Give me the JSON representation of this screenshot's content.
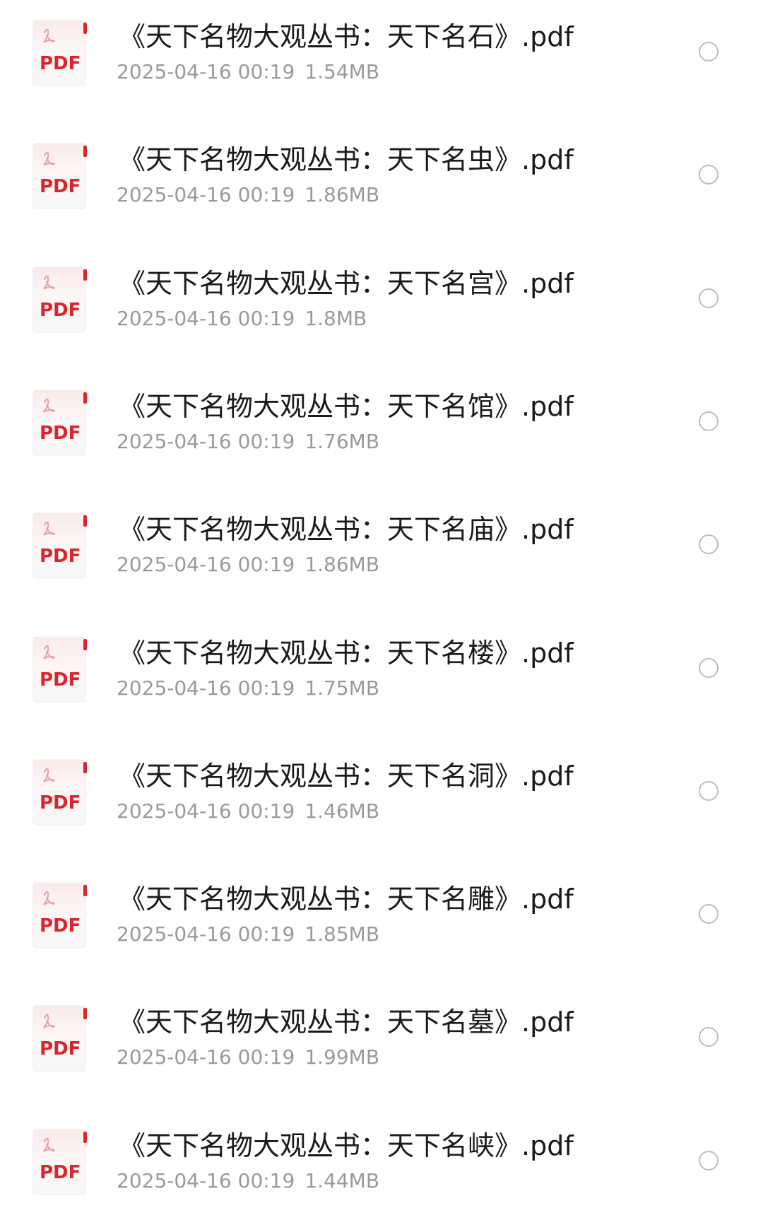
{
  "files": [
    {
      "name": "《天下名物大观丛书：天下名石》.pdf",
      "date": "2025-04-16 00:19",
      "size": "1.54MB",
      "icon": "pdf-file-icon",
      "icon_label": "PDF"
    },
    {
      "name": "《天下名物大观丛书：天下名虫》.pdf",
      "date": "2025-04-16 00:19",
      "size": "1.86MB",
      "icon": "pdf-file-icon",
      "icon_label": "PDF"
    },
    {
      "name": "《天下名物大观丛书：天下名宫》.pdf",
      "date": "2025-04-16 00:19",
      "size": "1.8MB",
      "icon": "pdf-file-icon",
      "icon_label": "PDF"
    },
    {
      "name": "《天下名物大观丛书：天下名馆》.pdf",
      "date": "2025-04-16 00:19",
      "size": "1.76MB",
      "icon": "pdf-file-icon",
      "icon_label": "PDF"
    },
    {
      "name": "《天下名物大观丛书：天下名庙》.pdf",
      "date": "2025-04-16 00:19",
      "size": "1.86MB",
      "icon": "pdf-file-icon",
      "icon_label": "PDF"
    },
    {
      "name": "《天下名物大观丛书：天下名楼》.pdf",
      "date": "2025-04-16 00:19",
      "size": "1.75MB",
      "icon": "pdf-file-icon",
      "icon_label": "PDF"
    },
    {
      "name": "《天下名物大观丛书：天下名洞》.pdf",
      "date": "2025-04-16 00:19",
      "size": "1.46MB",
      "icon": "pdf-file-icon",
      "icon_label": "PDF"
    },
    {
      "name": "《天下名物大观丛书：天下名雕》.pdf",
      "date": "2025-04-16 00:19",
      "size": "1.85MB",
      "icon": "pdf-file-icon",
      "icon_label": "PDF"
    },
    {
      "name": "《天下名物大观丛书：天下名墓》.pdf",
      "date": "2025-04-16 00:19",
      "size": "1.99MB",
      "icon": "pdf-file-icon",
      "icon_label": "PDF"
    },
    {
      "name": "《天下名物大观丛书：天下名峡》.pdf",
      "date": "2025-04-16 00:19",
      "size": "1.44MB",
      "icon": "pdf-file-icon",
      "icon_label": "PDF"
    }
  ],
  "colors": {
    "pdf_red": "#d9262c",
    "title_text": "#1a1a1a",
    "meta_text": "#9a9a9a",
    "radio_border": "#bdbdbd"
  },
  "selection": {
    "selected_count": 0
  }
}
